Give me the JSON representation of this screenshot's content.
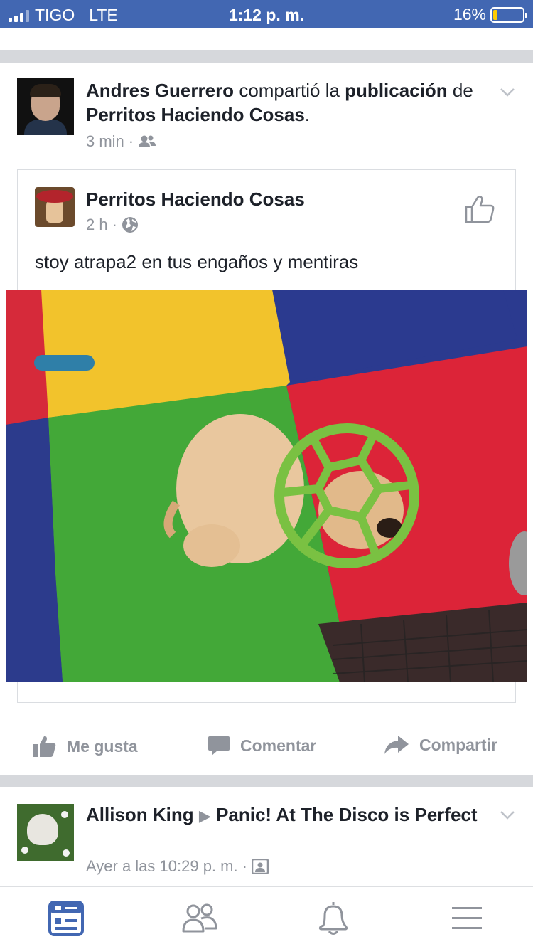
{
  "status_bar": {
    "carrier": "TIGO",
    "network": "LTE",
    "time": "1:12 p. m.",
    "battery": "16%",
    "battery_level": 0.16
  },
  "post1": {
    "author": "Andres Guerrero",
    "action_text": "compartió la",
    "object_text": "publicación",
    "prep_text": "de",
    "target": "Perritos Haciendo Cosas",
    "period": ".",
    "time": "3 min",
    "separator": "·",
    "audience_icon": "friends-icon",
    "shared": {
      "page_name": "Perritos Haciendo Cosas",
      "time": "2 h",
      "separator": "·",
      "audience_icon": "globe-icon",
      "text": "stoy atrapa2 en tus engaños y mentiras"
    },
    "actions": {
      "like": "Me gusta",
      "comment": "Comentar",
      "share": "Compartir"
    }
  },
  "post2": {
    "author": "Allison King",
    "arrow": "▶",
    "target": "Panic! At The Disco is Perfect",
    "time": "Ayer a las 10:29 p. m.",
    "separator": "·",
    "audience_icon": "group-icon"
  },
  "bottom_nav": [
    "news-feed-icon",
    "friends-icon",
    "notifications-icon",
    "menu-icon"
  ],
  "colors": {
    "brand": "#4267b2",
    "text": "#1d2129",
    "meta": "#90949c",
    "active": "#4267b2"
  }
}
